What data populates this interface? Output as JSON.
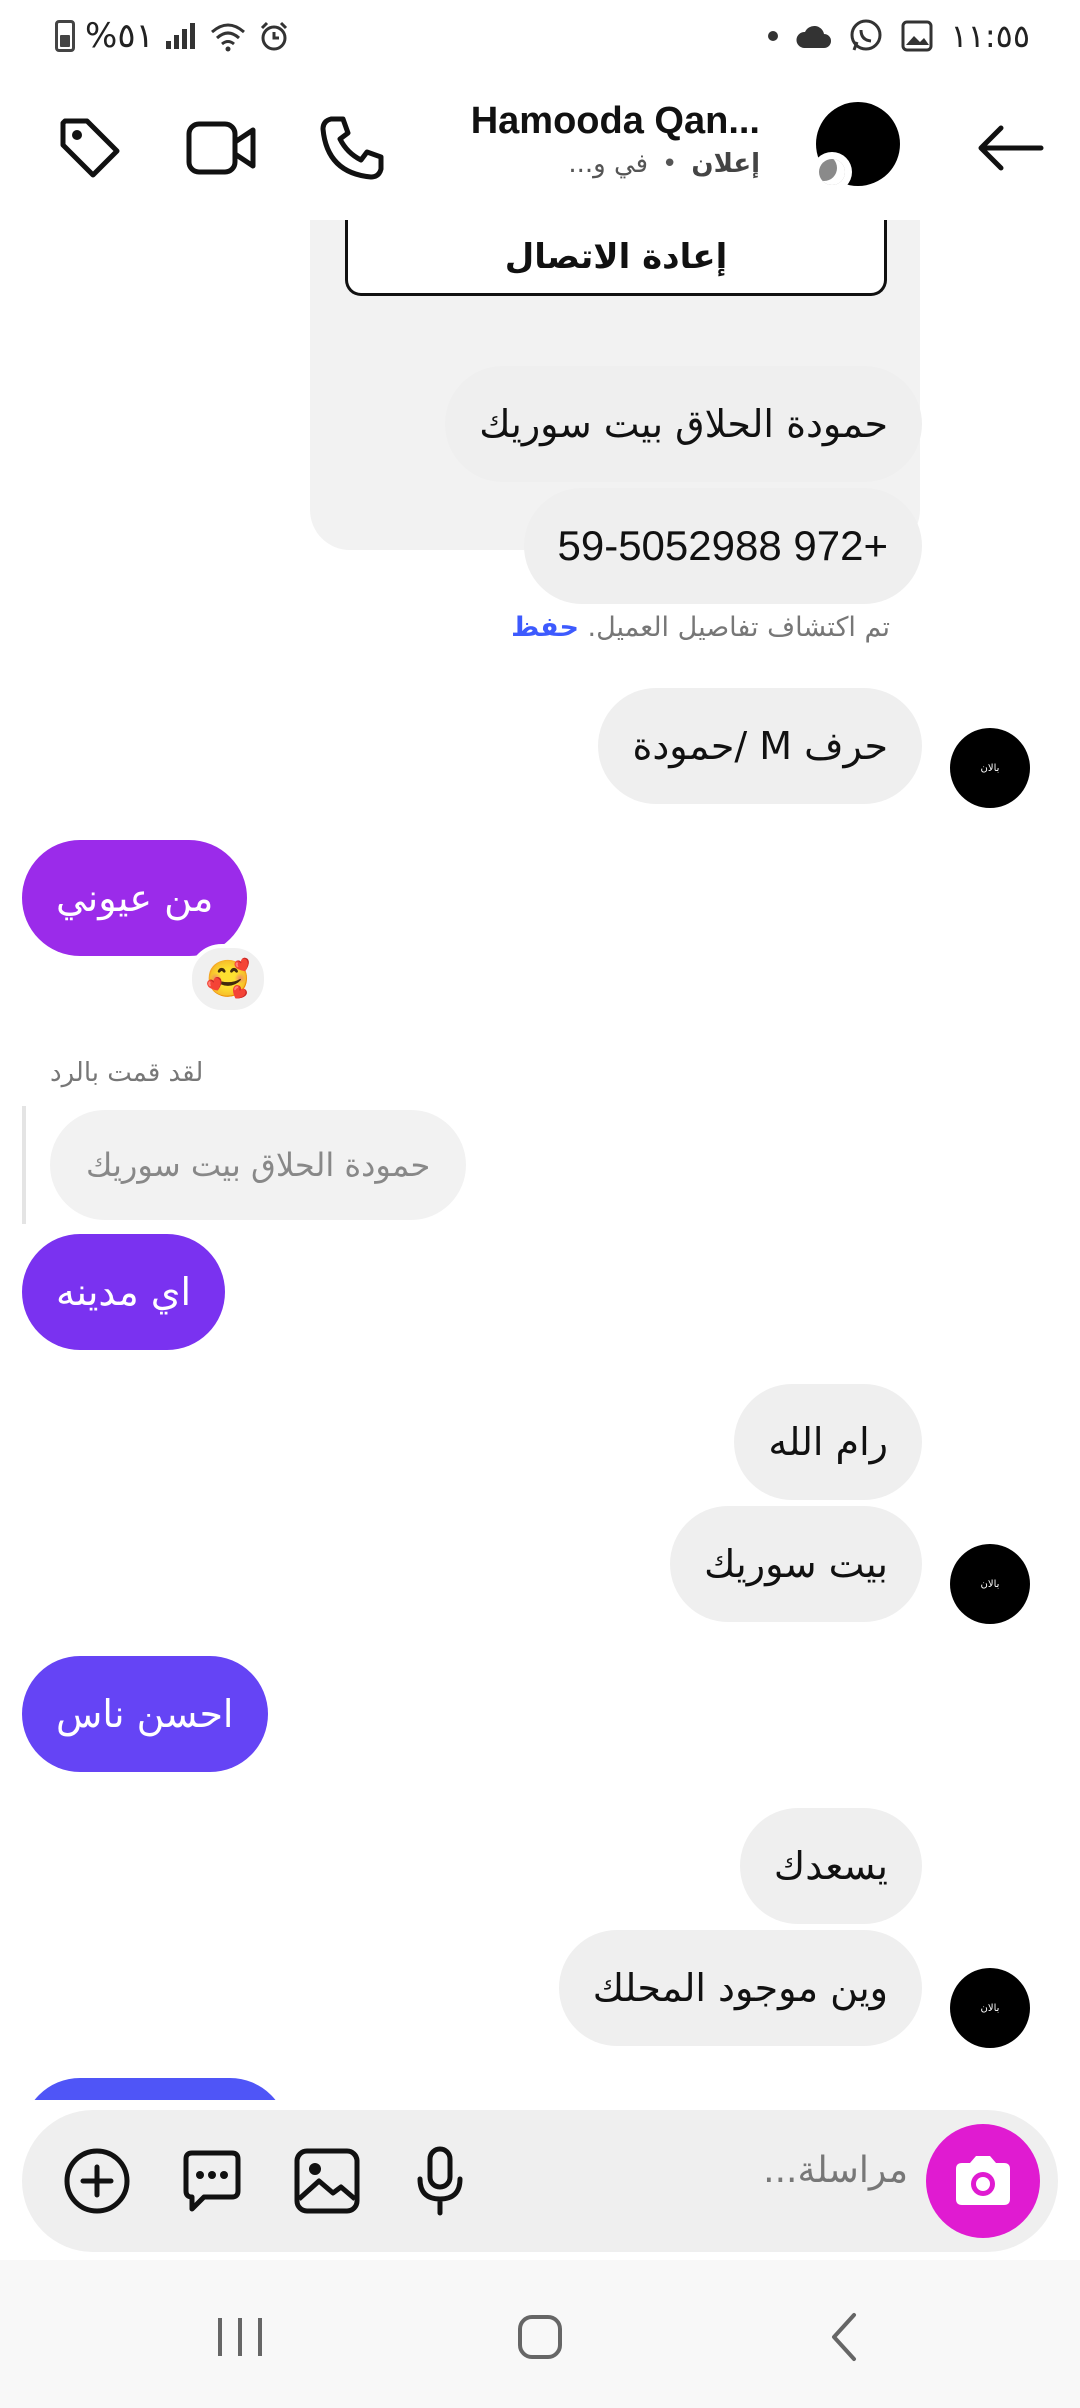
{
  "status_bar": {
    "time": "١١:٥٥",
    "battery_percent": "%٥١"
  },
  "header": {
    "contact_name": "Hamooda Qan...",
    "ad_label": "إعلان",
    "status_text": "في و..."
  },
  "chat": {
    "reconnect_label": "إعادة الاتصال",
    "messages": [
      {
        "side": "in",
        "text": "حمودة الحلاق بيت سوريك"
      },
      {
        "side": "in",
        "text": "+972 59-5052988"
      },
      {
        "side": "in",
        "text": "حرف M /حمودة"
      },
      {
        "side": "out",
        "text": "من عيوني",
        "color": "#9b2bea"
      },
      {
        "side": "out",
        "text": "اي مدينه",
        "color": "#7a32f0"
      },
      {
        "side": "in",
        "text": "رام الله"
      },
      {
        "side": "in",
        "text": "بيت سوريك"
      },
      {
        "side": "out",
        "text": "احسن ناس",
        "color": "#6544f5"
      },
      {
        "side": "in",
        "text": "يسعدك"
      },
      {
        "side": "in",
        "text": "وين موجود المحلك"
      }
    ],
    "customer_note": "تم اكتشاف تفاصيل العميل.",
    "save_label": "حفظ",
    "reaction_emoji": "🥰",
    "reply_label": "لقد قمت بالرد",
    "reply_quote": "حمودة الحلاق بيت سوريك",
    "avatar_caption": "بالان"
  },
  "composer": {
    "placeholder": "مراسلة..."
  },
  "colors": {
    "out_bubble_1": "#9b2bea",
    "out_bubble_2": "#7a32f0",
    "out_bubble_3": "#6544f5",
    "out_bubble_4": "#4f55f7",
    "camera_button": "#e01bd1",
    "save_link": "#3d5afe"
  }
}
